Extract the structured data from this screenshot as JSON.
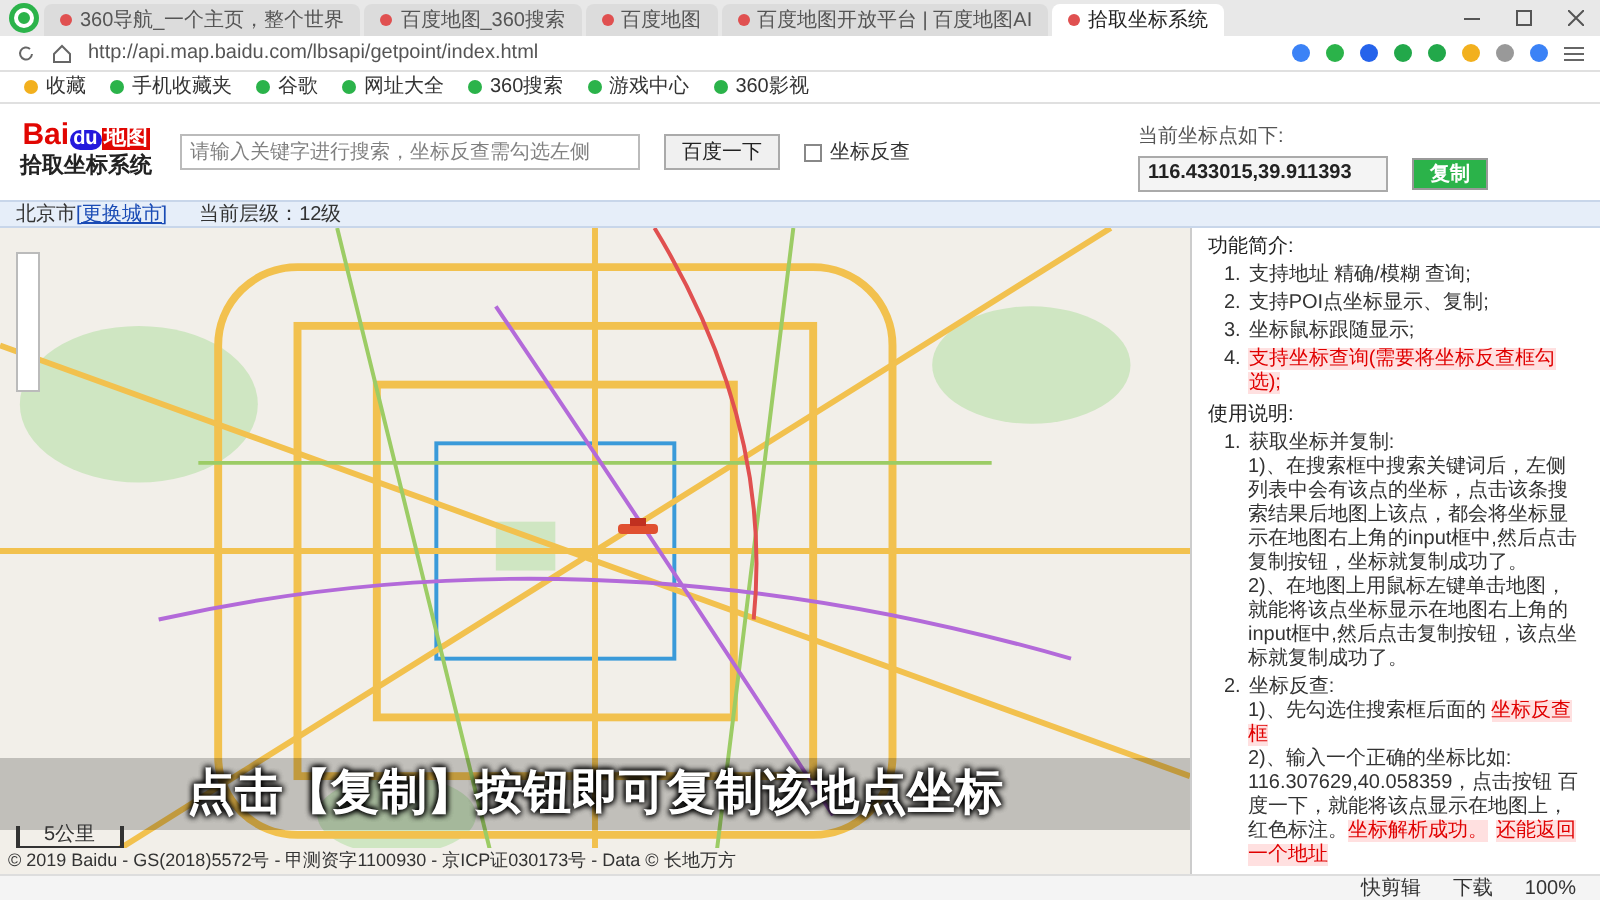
{
  "browser": {
    "tabs": [
      {
        "title": "360导航_一个主页，整个世界",
        "selected": false
      },
      {
        "title": "百度地图_360搜索",
        "selected": false
      },
      {
        "title": "百度地图",
        "selected": false
      },
      {
        "title": "百度地图开放平台 | 百度地图AI",
        "selected": false
      },
      {
        "title": "拾取坐标系统",
        "selected": true
      }
    ],
    "address": "http://api.map.baidu.com/lbsapi/getpoint/index.html",
    "bookmarks": [
      "收藏",
      "手机收藏夹",
      "谷歌",
      "网址大全",
      "360搜索",
      "游戏中心",
      "360影视"
    ]
  },
  "header": {
    "logo_bai": "Bai",
    "logo_du": "du",
    "logo_map": "地图",
    "subtitle": "拾取坐标系统",
    "search": {
      "placeholder": "请输入关键字进行搜索，坐标反查需勾选左侧"
    },
    "search_button": "百度一下",
    "reverse_lookup": {
      "label": "坐标反查",
      "checked": false
    },
    "coord_label": "当前坐标点如下:",
    "coord_value": "116.433015,39.911393",
    "copy_button": "复制"
  },
  "info_bar": {
    "city": "北京市",
    "change_city": "[更换城市]",
    "zoom_level": "当前层级：12级"
  },
  "map": {
    "caption": "点击【复制】按钮即可复制该地点坐标",
    "scale": "5公里",
    "copyright": "© 2019 Baidu - GS(2018)5572号 - 甲测资字1100930 - 京ICP证030173号 - Data © 长地万方"
  },
  "right_panel": {
    "sections": [
      {
        "title": "功能简介:",
        "items": [
          {
            "number": "1.",
            "segments": [
              {
                "text": "支持地址 精确/模糊 查询;",
                "highlight": false
              }
            ]
          },
          {
            "number": "2.",
            "segments": [
              {
                "text": "支持POI点坐标显示、复制;",
                "highlight": false
              }
            ]
          },
          {
            "number": "3.",
            "segments": [
              {
                "text": "坐标鼠标跟随显示;",
                "highlight": false
              }
            ]
          },
          {
            "number": "4.",
            "segments": [
              {
                "text": "支持坐标查询(需要将坐标反查框勾选);",
                "highlight": true
              }
            ]
          }
        ]
      },
      {
        "title": "使用说明:",
        "items": [
          {
            "number": "1.",
            "segments": [
              {
                "text": "获取坐标并复制:",
                "highlight": false
              }
            ],
            "children": [
              {
                "segments": [
                  {
                    "text": "1)、在搜索框中搜索关键词后，左侧列表中会有该点的坐标，点击该条搜索结果后地图上该点，都会将坐标显示在地图右上角的input框中,然后点击复制按钮，坐标就复制成功了。",
                    "highlight": false
                  }
                ]
              },
              {
                "segments": [
                  {
                    "text": "2)、在地图上用鼠标左键单击地图，就能将该点坐标显示在地图右上角的input框中,然后点击复制按钮，该点坐标就复制成功了。",
                    "highlight": false
                  }
                ]
              }
            ]
          },
          {
            "number": "2.",
            "segments": [
              {
                "text": "坐标反查:",
                "highlight": false
              }
            ],
            "children": [
              {
                "segments": [
                  {
                    "text": "1)、先勾选住搜索框后面的 ",
                    "highlight": false
                  },
                  {
                    "text": "坐标反查框",
                    "highlight": true
                  }
                ]
              },
              {
                "segments": [
                  {
                    "text": "2)、输入一个正确的坐标比如: 116.307629,40.058359，点击按钮 百度一下，就能将该点显示在地图上，红色标注。",
                    "highlight": false
                  },
                  {
                    "text": "坐标解析成功。",
                    "highlight": true
                  },
                  {
                    "text": "还能返回一个地址",
                    "highlight": true
                  }
                ]
              }
            ]
          }
        ]
      }
    ]
  },
  "status_bar": {
    "items": [
      "快剪辑",
      "下载",
      "100%"
    ]
  }
}
